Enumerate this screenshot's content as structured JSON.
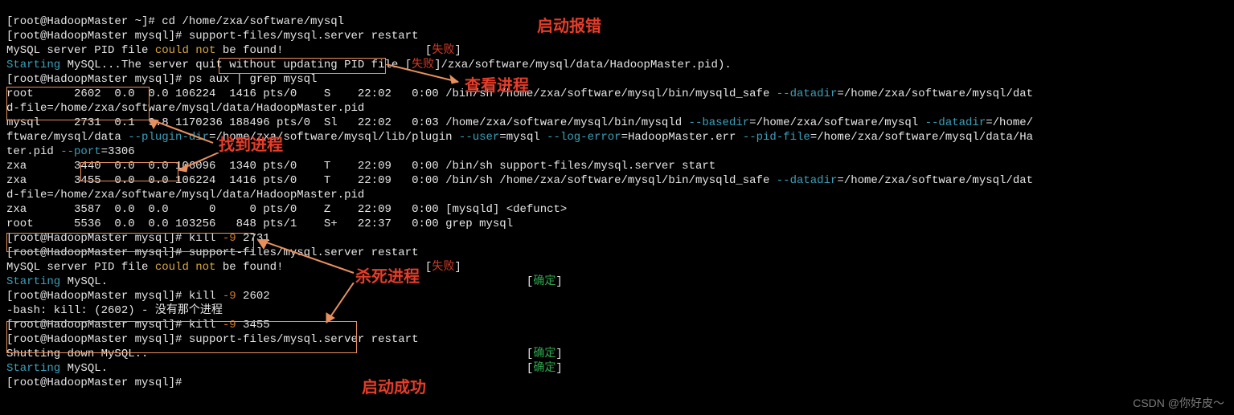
{
  "lines": {
    "l00": "[root@HadoopMaster ~]# cd /home/zxa/software/mysql",
    "l01": "[root@HadoopMaster mysql]# support-files/mysql.server restart",
    "l02a": "MySQL server PID file ",
    "l02b": "could not",
    "l02c": " be found!",
    "l02fail": "[",
    "l02fail2": "失败",
    "l02fail3": "]",
    "l03a": "Starting",
    "l03b": " MySQL...The server quit without updating PID file [",
    "l03fail": "失败",
    "l03c": "]/zxa/software/mysql/data/HadoopMaster.pid).",
    "l04": "[root@HadoopMaster mysql]# ps aux | grep mysql",
    "l05a": "root      2602  0.0  0.0 106224  1416 pts/0    S    22:02   0:00 /bin/sh /home/zxa/software/mysql/bin/mysqld_safe ",
    "l05b": "--datadir",
    "l05c": "=/home/zxa/software/mysql/dat",
    "l06": "d-file=/home/zxa/software/mysql/data/HadoopMaster.pid",
    "l07a": "mysql     2731  0.1  9.8 1170236 188496 pts/0  Sl   22:02   0:03 /home/zxa/software/mysql/bin/mysqld ",
    "l07b": "--basedir",
    "l07c": "=/home/zxa/software/mysql ",
    "l07d": "--datadir",
    "l07e": "=/home/",
    "l08a": "ftware/mysql/data ",
    "l08b": "--plugin-dir",
    "l08c": "=/home/zxa/software/mysql/lib/plugin ",
    "l08d": "--user",
    "l08e": "=mysql ",
    "l08f": "--log-error",
    "l08g": "=HadoopMaster.err ",
    "l08h": "--pid-file",
    "l08i": "=/home/zxa/software/mysql/data/Ha",
    "l09a": "ter.pid ",
    "l09b": "--port",
    "l09c": "=3306",
    "l10": "zxa       3440  0.0  0.0 106096  1340 pts/0    T    22:09   0:00 /bin/sh support-files/mysql.server start",
    "l11a": "zxa       3455  0.0  0.0 106224  1416 pts/0    T    22:09   0:00 /bin/sh /home/zxa/software/mysql/bin/mysqld_safe ",
    "l11b": "--datadir",
    "l11c": "=/home/zxa/software/mysql/dat",
    "l12": "d-file=/home/zxa/software/mysql/data/HadoopMaster.pid",
    "l13": "zxa       3587  0.0  0.0      0     0 pts/0    Z    22:09   0:00 [mysqld] <defunct>",
    "l14": "root      5536  0.0  0.0 103256   848 pts/1    S+   22:37   0:00 grep mysql",
    "l15a": "[root@HadoopMaster mysql]# kill ",
    "l15b": "-9",
    "l15c": " 2731",
    "l16": "[root@HadoopMaster mysql]# support-files/mysql.server restart",
    "l17a": "MySQL server PID file ",
    "l17b": "could not",
    "l17c": " be found!",
    "l17fail_o": "[",
    "l17fail": "失败",
    "l17fail_c": "]",
    "l18a": "Starting",
    "l18b": " MySQL.",
    "l18ok_o": "[",
    "l18ok": "确定",
    "l18ok_c": "]",
    "l19a": "[root@HadoopMaster mysql]# kill ",
    "l19b": "-9",
    "l19c": " 2602",
    "l20": "-bash: kill: (2602) - 没有那个进程",
    "l21a": "[root@HadoopMaster mysql]# kill ",
    "l21b": "-9",
    "l21c": " 3455",
    "l22": "[root@HadoopMaster mysql]# support-files/mysql.server restart",
    "l23": "Shutting down MySQL..",
    "l23ok_o": "[",
    "l23ok": "确定",
    "l23ok_c": "]",
    "l24a": "Starting",
    "l24b": " MySQL.",
    "l24ok_o": "[",
    "l24ok": "确定",
    "l24ok_c": "]",
    "l25": "[root@HadoopMaster mysql]#"
  },
  "annotations": {
    "start_error": "启动报错",
    "view_proc": "查看进程",
    "find_proc": "找到进程",
    "kill_proc": "杀死进程",
    "start_ok": "启动成功"
  },
  "watermark": "CSDN @你好皮～"
}
